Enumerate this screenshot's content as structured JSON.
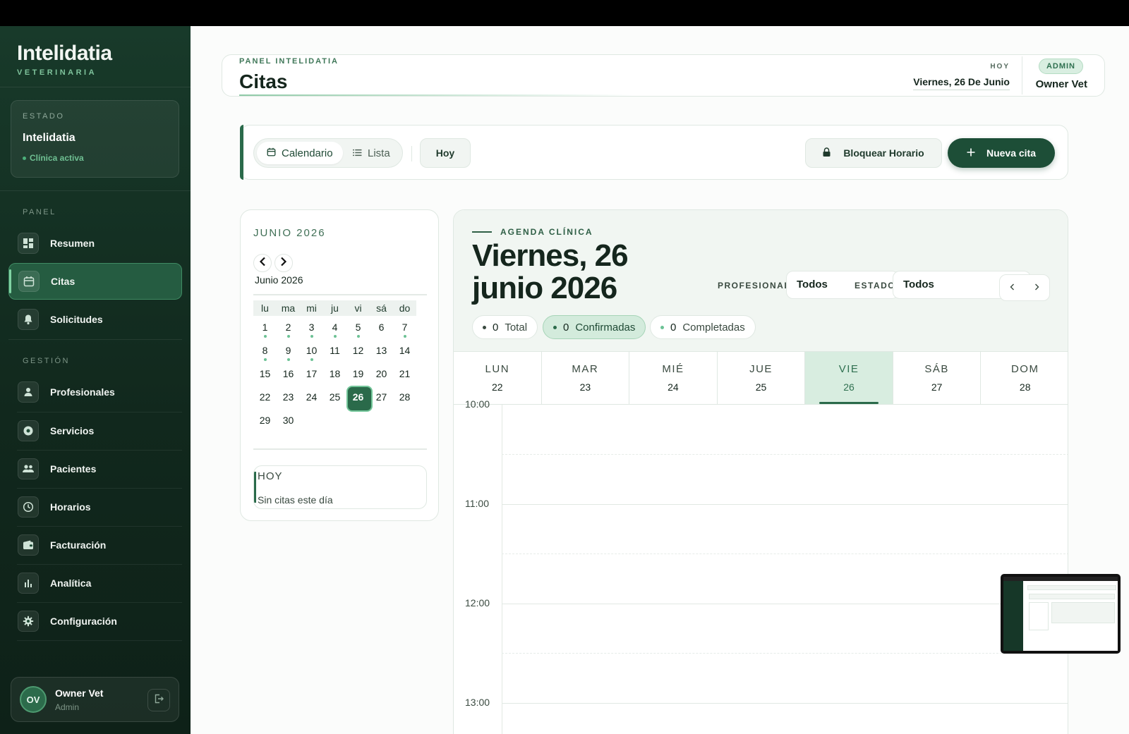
{
  "brand": {
    "name": "Intelidatia",
    "subtitle": "VETERINARIA"
  },
  "estado": {
    "label": "ESTADO",
    "name": "Intelidatia",
    "status": "Clínica activa"
  },
  "sidebar": {
    "panel_label": "PANEL",
    "gestion_label": "GESTIÓN",
    "panel_items": [
      {
        "label": "Resumen",
        "icon": "dashboard-icon"
      },
      {
        "label": "Citas",
        "icon": "calendar-icon",
        "active": true
      },
      {
        "label": "Solicitudes",
        "icon": "bell-icon"
      }
    ],
    "gestion_items": [
      {
        "label": "Profesionales",
        "icon": "person-icon"
      },
      {
        "label": "Servicios",
        "icon": "stethoscope-icon"
      },
      {
        "label": "Pacientes",
        "icon": "group-icon"
      },
      {
        "label": "Horarios",
        "icon": "clock-icon"
      },
      {
        "label": "Facturación",
        "icon": "wallet-icon"
      },
      {
        "label": "Analítica",
        "icon": "bar-chart-icon"
      },
      {
        "label": "Configuración",
        "icon": "gear-icon"
      }
    ]
  },
  "user": {
    "initials": "OV",
    "name": "Owner Vet",
    "role": "Admin"
  },
  "header": {
    "eyebrow": "PANEL INTELIDATIA",
    "title": "Citas",
    "today_label": "HOY",
    "today_value": "Viernes, 26 De Junio",
    "badge": "ADMIN",
    "user": "Owner Vet"
  },
  "toolbar": {
    "view_calendar": "Calendario",
    "view_list": "Lista",
    "today_button": "Hoy",
    "block_button": "Bloquear Horario",
    "new_button": "Nueva cita"
  },
  "mini_calendar": {
    "title": "JUNIO 2026",
    "month_label": "Junio 2026",
    "weekdays": [
      "lu",
      "ma",
      "mi",
      "ju",
      "vi",
      "sá",
      "do"
    ],
    "weeks": [
      [
        "1",
        "2",
        "3",
        "4",
        "5",
        "6",
        "7"
      ],
      [
        "8",
        "9",
        "10",
        "11",
        "12",
        "13",
        "14"
      ],
      [
        "15",
        "16",
        "17",
        "18",
        "19",
        "20",
        "21"
      ],
      [
        "22",
        "23",
        "24",
        "25",
        "26",
        "27",
        "28"
      ],
      [
        "29",
        "30",
        "",
        "",
        "",
        "",
        ""
      ]
    ],
    "days_with_appointments": [
      "1",
      "2",
      "3",
      "4",
      "5",
      "7",
      "8",
      "9",
      "10"
    ],
    "selected_day": "26",
    "today_label": "HOY",
    "today_text": "Sin citas este día"
  },
  "agenda": {
    "eyebrow": "AGENDA CLÍNICA",
    "title": "Viernes, 26 junio 2026",
    "filter_profesional_label": "PROFESIONAL",
    "filter_profesional_value": "Todos",
    "filter_estado_label": "ESTADO",
    "filter_estado_value": "Todos",
    "chips": [
      {
        "count": "0",
        "label": "Total"
      },
      {
        "count": "0",
        "label": "Confirmadas"
      },
      {
        "count": "0",
        "label": "Completadas"
      }
    ],
    "week": [
      {
        "name": "LUN",
        "num": "22"
      },
      {
        "name": "MAR",
        "num": "23"
      },
      {
        "name": "MIÉ",
        "num": "24"
      },
      {
        "name": "JUE",
        "num": "25"
      },
      {
        "name": "VIE",
        "num": "26",
        "today": true
      },
      {
        "name": "SÁB",
        "num": "27"
      },
      {
        "name": "DOM",
        "num": "28"
      }
    ],
    "times": [
      "10:00",
      "11:00",
      "12:00",
      "13:00"
    ]
  },
  "colors": {
    "sidebar": "#183a2a",
    "accent": "#2a6a4a",
    "accent_light": "#d8ede0",
    "primary_button": "#1d4e37"
  }
}
